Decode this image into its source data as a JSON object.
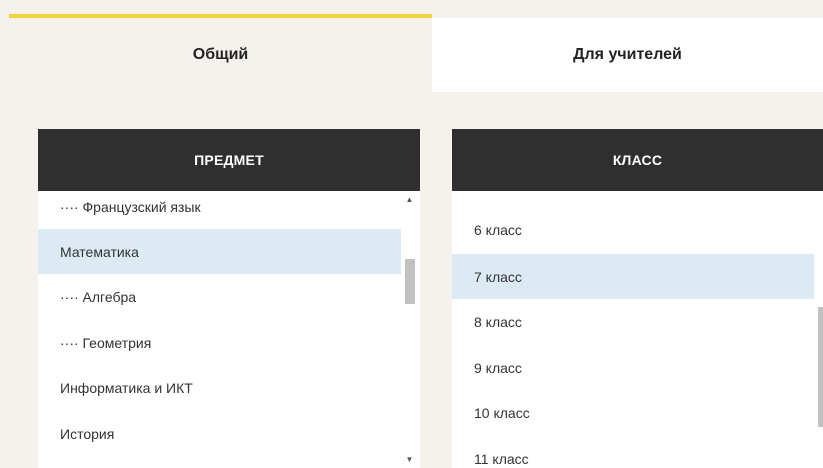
{
  "tabs": {
    "general": "Общий",
    "teachers": "Для учителей"
  },
  "subject_panel": {
    "header": "ПРЕДМЕТ",
    "items": [
      "···· Французский язык",
      "Математика",
      "···· Алгебра",
      "···· Геометрия",
      "Информатика и ИКТ",
      "История"
    ],
    "selected": "Математика"
  },
  "class_panel": {
    "header": "КЛАСС",
    "items": [
      "6 класс",
      "7 класс",
      "8 класс",
      "9 класс",
      "10 класс",
      "11 класс"
    ],
    "selected": "7 класс"
  },
  "colors": {
    "accent": "#f2d336",
    "header_bg": "#2f2f2f",
    "selected_bg": "#dceaf3",
    "page_bg": "#f5f2ed"
  }
}
